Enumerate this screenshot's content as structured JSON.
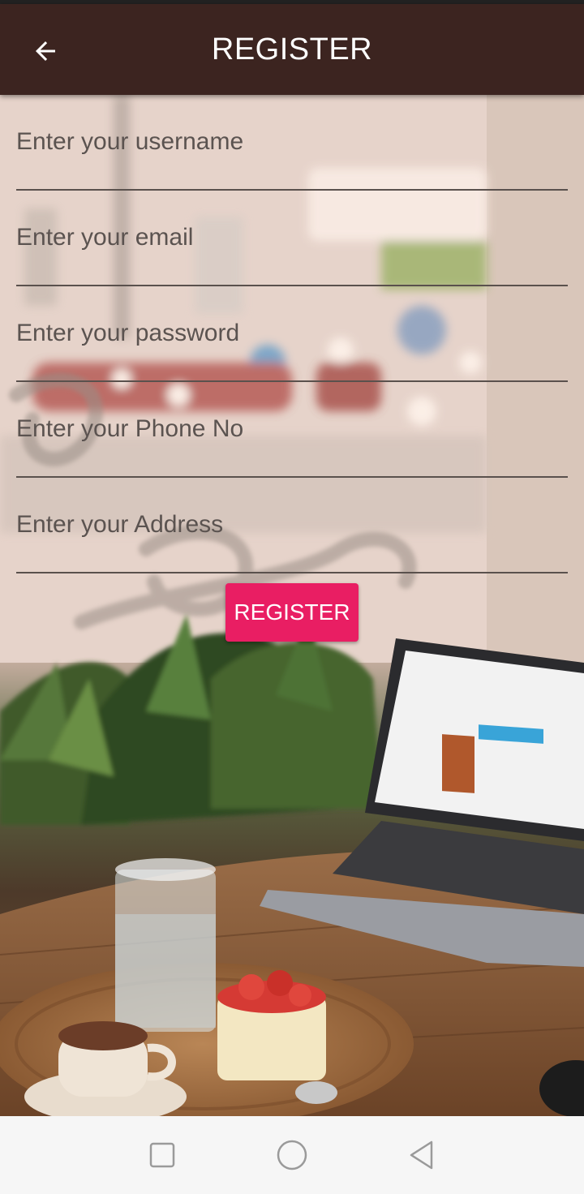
{
  "app_bar": {
    "title": "REGISTER",
    "back_icon": "arrow-left-icon",
    "background": "#3c2420"
  },
  "form": {
    "fields": [
      {
        "name": "username",
        "placeholder": "Enter your username",
        "value": ""
      },
      {
        "name": "email",
        "placeholder": "Enter your email",
        "value": ""
      },
      {
        "name": "password",
        "placeholder": "Enter your password",
        "value": ""
      },
      {
        "name": "phone",
        "placeholder": "Enter your Phone No",
        "value": ""
      },
      {
        "name": "address",
        "placeholder": "Enter your Address",
        "value": ""
      }
    ],
    "submit_label": "REGISTER",
    "accent": "#e91e63"
  },
  "nav_bar": {
    "icons": [
      "recents-square-icon",
      "home-circle-icon",
      "back-triangle-icon"
    ]
  }
}
